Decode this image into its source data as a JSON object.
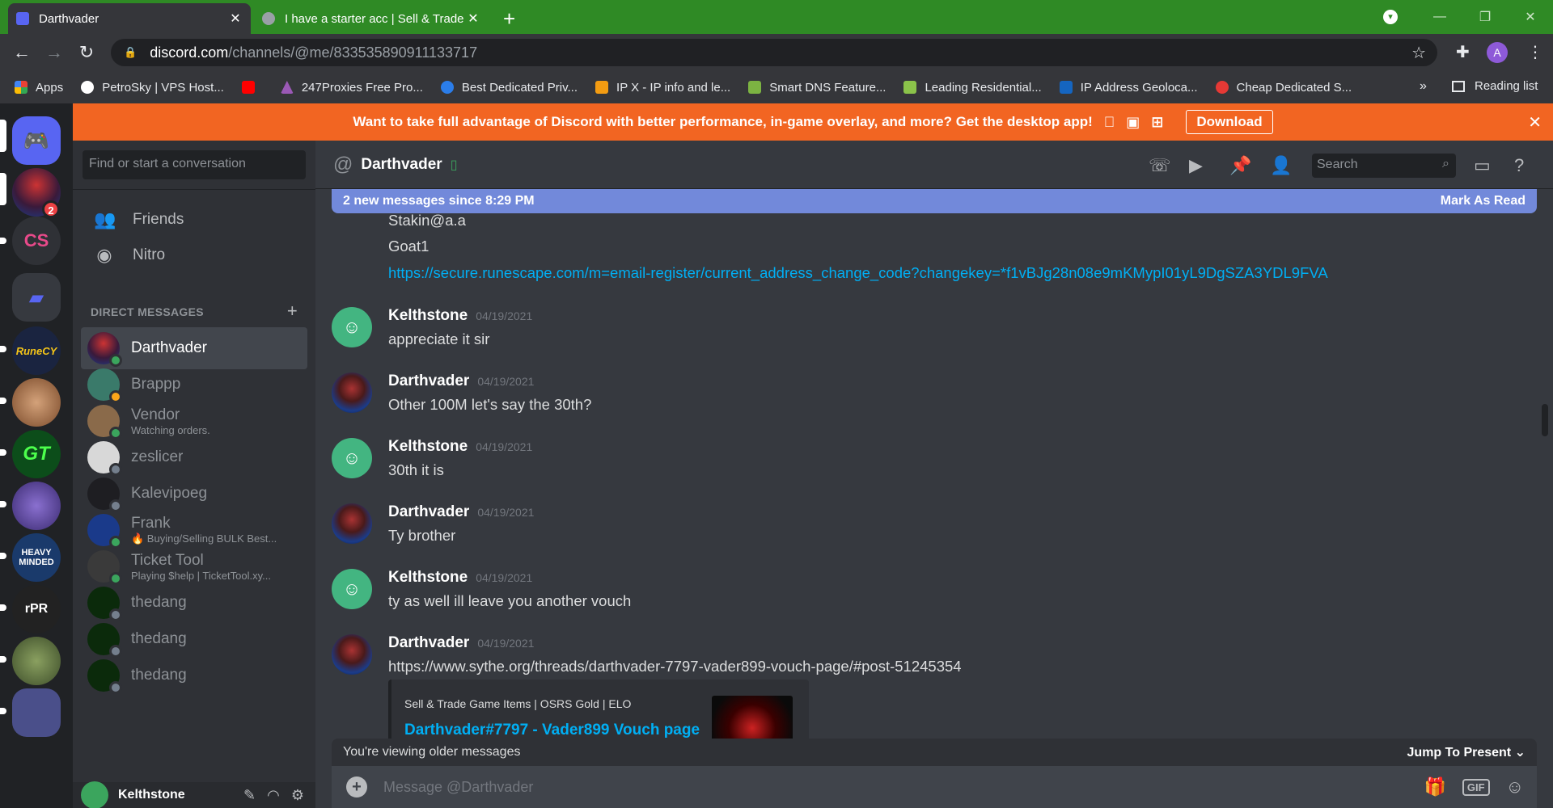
{
  "browser": {
    "tabs": [
      {
        "title": "Darthvader",
        "close": "✕"
      },
      {
        "title": "I have a starter acc | Sell & Trade",
        "close": "✕"
      }
    ],
    "new_tab": "+",
    "window_controls": [
      "—",
      "❐",
      "✕"
    ],
    "url_host": "discord.com",
    "url_path": "/channels/@me/833535890911133717",
    "bookmarks": [
      {
        "label": "Apps",
        "color": "#e94235"
      },
      {
        "label": "PetroSky | VPS Host...",
        "color": "#ffffff"
      },
      {
        "label": "",
        "color": "#ff0000"
      },
      {
        "label": "247Proxies Free Pro...",
        "color": "#9b59b6"
      },
      {
        "label": "Best Dedicated Priv...",
        "color": "#2b7de9"
      },
      {
        "label": "IP X - IP info and le...",
        "color": "#f39c12"
      },
      {
        "label": "Smart DNS Feature...",
        "color": "#7cb342"
      },
      {
        "label": "Leading Residential...",
        "color": "#8bc34a"
      },
      {
        "label": "IP Address Geoloca...",
        "color": "#1565c0"
      },
      {
        "label": "Cheap Dedicated S...",
        "color": "#e53935"
      }
    ],
    "bookmarks_more": "»",
    "reading_list": "Reading list",
    "profile_initial": "A"
  },
  "banner": {
    "text": "Want to take full advantage of Discord with better performance, in-game overlay, and more? Get the desktop app!",
    "download": "Download",
    "close": "✕"
  },
  "guilds": [
    {
      "label": "",
      "color": "#5865f2"
    },
    {
      "label": "",
      "color": "#6b2a1c",
      "badge": "2"
    },
    {
      "label": "CS",
      "color": "#2f3136"
    },
    {
      "label": "",
      "color": "#36393f"
    },
    {
      "label": "RuneCY",
      "color": "#1a2440"
    },
    {
      "label": "",
      "color": "#b4825a"
    },
    {
      "label": "GT",
      "color": "#0c4d1a"
    },
    {
      "label": "",
      "color": "#4b3a85"
    },
    {
      "label": "HEAVY MINDED",
      "color": "#1a3a6b"
    },
    {
      "label": "rPR",
      "color": "#222"
    },
    {
      "label": "",
      "color": "#3d4d2a"
    },
    {
      "label": "",
      "color": "#36393f"
    }
  ],
  "sidebar": {
    "search_placeholder": "Find or start a conversation",
    "friends": "Friends",
    "nitro": "Nitro",
    "dm_header": "DIRECT MESSAGES",
    "dm_add": "+",
    "dms": [
      {
        "name": "Darthvader",
        "sub": "",
        "status": "#3ba55d",
        "avatar": "#5a2a3a"
      },
      {
        "name": "Brappp",
        "sub": "",
        "status": "#faa61a",
        "avatar": "#3a7a6a"
      },
      {
        "name": "Vendor",
        "sub": "Watching orders.",
        "status": "#3ba55d",
        "avatar": "#8a6a4a"
      },
      {
        "name": "zeslicer",
        "sub": "",
        "status": "#747f8d",
        "avatar": "#d8d8d8"
      },
      {
        "name": "Kalevipoeg",
        "sub": "",
        "status": "#747f8d",
        "avatar": "#1e1e22"
      },
      {
        "name": "Frank",
        "sub": "🔥 Buying/Selling BULK Best...",
        "status": "#3ba55d",
        "avatar": "#1a3a8a"
      },
      {
        "name": "Ticket Tool",
        "sub": "Playing $help | TicketTool.xy...",
        "status": "#3ba55d",
        "avatar": "#3a3a3a"
      },
      {
        "name": "thedang",
        "sub": "",
        "status": "#747f8d",
        "avatar": "#0b2a0b"
      },
      {
        "name": "thedang",
        "sub": "",
        "status": "#747f8d",
        "avatar": "#0b2a0b"
      },
      {
        "name": "thedang",
        "sub": "",
        "status": "#747f8d",
        "avatar": "#0b2a0b"
      }
    ],
    "user": "Kelthstone"
  },
  "chat": {
    "channel": "Darthvader",
    "search_placeholder": "Search",
    "new_messages": "2 new messages since 8:29 PM",
    "mark_as_read": "Mark As Read",
    "leading_lines": [
      "Stakin@a.a",
      "Goat1",
      "https://secure.runescape.com/m=email-register/current_address_change_code?changekey=*f1vBJg28n08e9mKMypI01yL9DgSZA3YDL9FVA"
    ],
    "messages": [
      {
        "author": "Kelthstone",
        "timestamp": "04/19/2021",
        "text": "appreciate it sir"
      },
      {
        "author": "Darthvader",
        "timestamp": "04/19/2021",
        "text": "Other 100M let's say the 30th?"
      },
      {
        "author": "Kelthstone",
        "timestamp": "04/19/2021",
        "text": "30th it is"
      },
      {
        "author": "Darthvader",
        "timestamp": "04/19/2021",
        "text": "Ty brother"
      },
      {
        "author": "Kelthstone",
        "timestamp": "04/19/2021",
        "text": "ty as well ill leave you another vouch"
      },
      {
        "author": "Darthvader",
        "timestamp": "04/19/2021",
        "text": "https://www.sythe.org/threads/darthvader-7797-vader899-vouch-page/#post-51245354"
      }
    ],
    "embed": {
      "provider": "Sell & Trade Game Items | OSRS Gold | ELO",
      "title": "Darthvader#7797 - Vader899 Vouch page"
    },
    "older_notice": "You're viewing older messages",
    "jump": "Jump To Present",
    "composer_placeholder": "Message @Darthvader",
    "gif": "GIF"
  }
}
